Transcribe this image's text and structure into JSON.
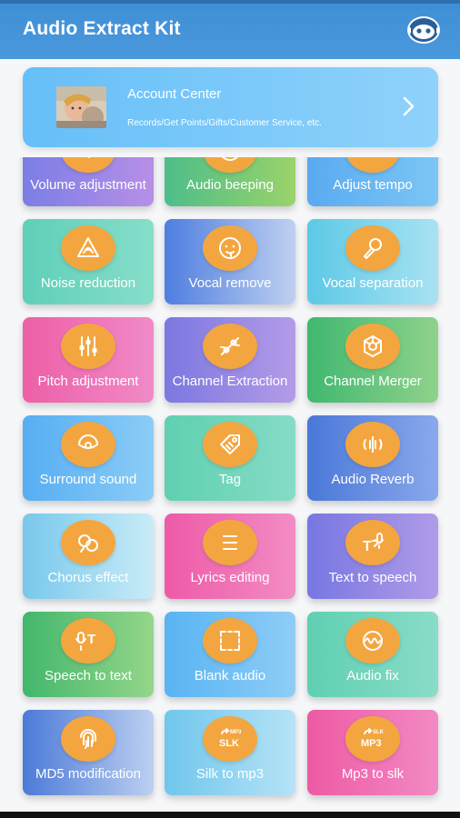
{
  "app": {
    "title": "Audio Extract Kit",
    "header_icon": "robot-avatar-icon",
    "header_color": "#4a98dc",
    "accent_color": "#f3a63f"
  },
  "account": {
    "title": "Account Center",
    "subtitle": "Records/Get Points/Gifts/Customer Service, etc.",
    "chevron_icon": "chevron-right-icon"
  },
  "tiles": [
    {
      "label": "Volume adjustment",
      "icon": "volume-icon",
      "name": "volume-adjustment",
      "gradient": [
        "#7b7ee6",
        "#b78fe7"
      ]
    },
    {
      "label": "Audio beeping",
      "icon": "beep-face-icon",
      "name": "audio-beeping",
      "gradient": [
        "#4dbd8a",
        "#9ad36a"
      ]
    },
    {
      "label": "Adjust tempo",
      "icon": "tempo-icon",
      "name": "adjust-tempo",
      "gradient": [
        "#5aaaf0",
        "#7bc6f5"
      ]
    },
    {
      "label": "Noise reduction",
      "icon": "noise-warning-icon",
      "name": "noise-reduction",
      "gradient": [
        "#5fcfb8",
        "#86dec9"
      ]
    },
    {
      "label": "Vocal remove",
      "icon": "vocal-remove-face-icon",
      "name": "vocal-remove",
      "gradient": [
        "#4e7ee0",
        "#bfd0f0"
      ]
    },
    {
      "label": "Vocal separation",
      "icon": "microphone-icon",
      "name": "vocal-separation",
      "gradient": [
        "#5cc9e6",
        "#a8e2f2"
      ]
    },
    {
      "label": "Pitch adjustment",
      "icon": "sliders-icon",
      "name": "pitch-adjustment",
      "gradient": [
        "#ee5fa8",
        "#f08ac8"
      ]
    },
    {
      "label": "Channel Extraction",
      "icon": "channel-extract-icon",
      "name": "channel-extraction",
      "gradient": [
        "#7b78e0",
        "#b49be8"
      ]
    },
    {
      "label": "Channel Merger",
      "icon": "channel-merge-icon",
      "name": "channel-merger",
      "gradient": [
        "#40b870",
        "#8fd28a"
      ]
    },
    {
      "label": "Surround sound",
      "icon": "surround-icon",
      "name": "surround-sound",
      "gradient": [
        "#56aef2",
        "#8cccf7"
      ]
    },
    {
      "label": "Tag",
      "icon": "tag-icon",
      "name": "tag",
      "gradient": [
        "#5fd0b0",
        "#86dcc6"
      ]
    },
    {
      "label": "Audio Reverb",
      "icon": "reverb-icon",
      "name": "audio-reverb",
      "gradient": [
        "#4a78d8",
        "#8aa8ec"
      ]
    },
    {
      "label": "Chorus effect",
      "icon": "chorus-icon",
      "name": "chorus-effect",
      "gradient": [
        "#78c8ec",
        "#c9ecf7"
      ]
    },
    {
      "label": "Lyrics editing",
      "icon": "lyrics-icon",
      "name": "lyrics-editing",
      "gradient": [
        "#ee5aa8",
        "#f28cc4"
      ]
    },
    {
      "label": "Text to speech",
      "icon": "text-to-speech-icon",
      "name": "text-to-speech",
      "gradient": [
        "#7777e2",
        "#b19be8"
      ]
    },
    {
      "label": "Speech to text",
      "icon": "speech-to-text-icon",
      "name": "speech-to-text",
      "gradient": [
        "#42b76c",
        "#95d68a"
      ]
    },
    {
      "label": "Blank audio",
      "icon": "blank-audio-icon",
      "name": "blank-audio",
      "gradient": [
        "#58b4f2",
        "#8ecdf7"
      ]
    },
    {
      "label": "Audio fix",
      "icon": "audio-fix-icon",
      "name": "audio-fix",
      "gradient": [
        "#5fd0b2",
        "#8adcc8"
      ]
    },
    {
      "label": "MD5 modification",
      "icon": "fingerprint-icon",
      "name": "md5-modification",
      "gradient": [
        "#4c7ad8",
        "#bcd0f0"
      ]
    },
    {
      "label": "Silk to mp3",
      "icon": "silk-to-mp3-icon",
      "name": "silk-to-mp3",
      "gradient": [
        "#6fc6ec",
        "#b6e3f6"
      ]
    },
    {
      "label": "Mp3 to slk",
      "icon": "mp3-to-slk-icon",
      "name": "mp3-to-slk",
      "gradient": [
        "#ee5aa4",
        "#f28ac4"
      ]
    }
  ],
  "icon_text": {
    "silk_small": "MP3",
    "silk_big": "SLK",
    "mp3_small": "SLK",
    "mp3_big": "MP3",
    "stt_letter": "T",
    "tts_letter": "T"
  }
}
